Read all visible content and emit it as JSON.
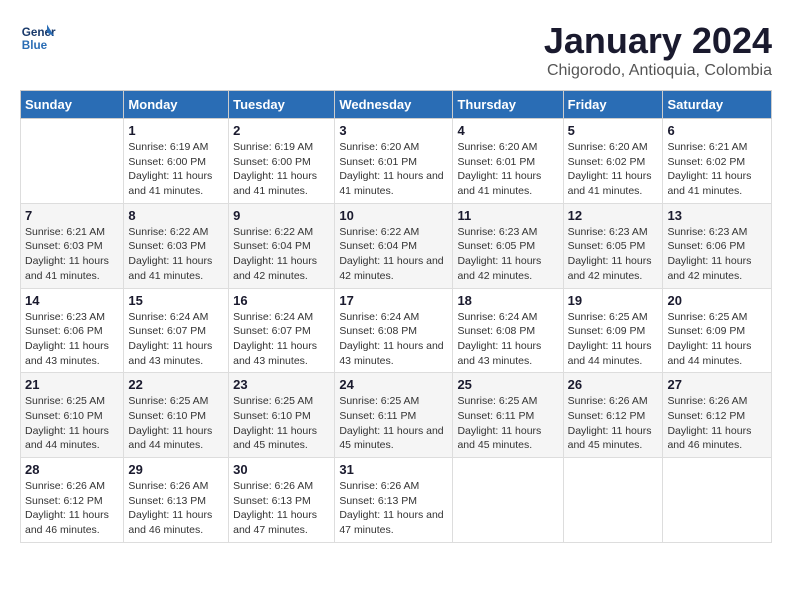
{
  "logo": {
    "line1": "General",
    "line2": "Blue"
  },
  "title": "January 2024",
  "subtitle": "Chigorodo, Antioquia, Colombia",
  "days_of_week": [
    "Sunday",
    "Monday",
    "Tuesday",
    "Wednesday",
    "Thursday",
    "Friday",
    "Saturday"
  ],
  "weeks": [
    [
      {
        "num": "",
        "sunrise": "",
        "sunset": "",
        "daylight": ""
      },
      {
        "num": "1",
        "sunrise": "Sunrise: 6:19 AM",
        "sunset": "Sunset: 6:00 PM",
        "daylight": "Daylight: 11 hours and 41 minutes."
      },
      {
        "num": "2",
        "sunrise": "Sunrise: 6:19 AM",
        "sunset": "Sunset: 6:00 PM",
        "daylight": "Daylight: 11 hours and 41 minutes."
      },
      {
        "num": "3",
        "sunrise": "Sunrise: 6:20 AM",
        "sunset": "Sunset: 6:01 PM",
        "daylight": "Daylight: 11 hours and 41 minutes."
      },
      {
        "num": "4",
        "sunrise": "Sunrise: 6:20 AM",
        "sunset": "Sunset: 6:01 PM",
        "daylight": "Daylight: 11 hours and 41 minutes."
      },
      {
        "num": "5",
        "sunrise": "Sunrise: 6:20 AM",
        "sunset": "Sunset: 6:02 PM",
        "daylight": "Daylight: 11 hours and 41 minutes."
      },
      {
        "num": "6",
        "sunrise": "Sunrise: 6:21 AM",
        "sunset": "Sunset: 6:02 PM",
        "daylight": "Daylight: 11 hours and 41 minutes."
      }
    ],
    [
      {
        "num": "7",
        "sunrise": "Sunrise: 6:21 AM",
        "sunset": "Sunset: 6:03 PM",
        "daylight": "Daylight: 11 hours and 41 minutes."
      },
      {
        "num": "8",
        "sunrise": "Sunrise: 6:22 AM",
        "sunset": "Sunset: 6:03 PM",
        "daylight": "Daylight: 11 hours and 41 minutes."
      },
      {
        "num": "9",
        "sunrise": "Sunrise: 6:22 AM",
        "sunset": "Sunset: 6:04 PM",
        "daylight": "Daylight: 11 hours and 42 minutes."
      },
      {
        "num": "10",
        "sunrise": "Sunrise: 6:22 AM",
        "sunset": "Sunset: 6:04 PM",
        "daylight": "Daylight: 11 hours and 42 minutes."
      },
      {
        "num": "11",
        "sunrise": "Sunrise: 6:23 AM",
        "sunset": "Sunset: 6:05 PM",
        "daylight": "Daylight: 11 hours and 42 minutes."
      },
      {
        "num": "12",
        "sunrise": "Sunrise: 6:23 AM",
        "sunset": "Sunset: 6:05 PM",
        "daylight": "Daylight: 11 hours and 42 minutes."
      },
      {
        "num": "13",
        "sunrise": "Sunrise: 6:23 AM",
        "sunset": "Sunset: 6:06 PM",
        "daylight": "Daylight: 11 hours and 42 minutes."
      }
    ],
    [
      {
        "num": "14",
        "sunrise": "Sunrise: 6:23 AM",
        "sunset": "Sunset: 6:06 PM",
        "daylight": "Daylight: 11 hours and 43 minutes."
      },
      {
        "num": "15",
        "sunrise": "Sunrise: 6:24 AM",
        "sunset": "Sunset: 6:07 PM",
        "daylight": "Daylight: 11 hours and 43 minutes."
      },
      {
        "num": "16",
        "sunrise": "Sunrise: 6:24 AM",
        "sunset": "Sunset: 6:07 PM",
        "daylight": "Daylight: 11 hours and 43 minutes."
      },
      {
        "num": "17",
        "sunrise": "Sunrise: 6:24 AM",
        "sunset": "Sunset: 6:08 PM",
        "daylight": "Daylight: 11 hours and 43 minutes."
      },
      {
        "num": "18",
        "sunrise": "Sunrise: 6:24 AM",
        "sunset": "Sunset: 6:08 PM",
        "daylight": "Daylight: 11 hours and 43 minutes."
      },
      {
        "num": "19",
        "sunrise": "Sunrise: 6:25 AM",
        "sunset": "Sunset: 6:09 PM",
        "daylight": "Daylight: 11 hours and 44 minutes."
      },
      {
        "num": "20",
        "sunrise": "Sunrise: 6:25 AM",
        "sunset": "Sunset: 6:09 PM",
        "daylight": "Daylight: 11 hours and 44 minutes."
      }
    ],
    [
      {
        "num": "21",
        "sunrise": "Sunrise: 6:25 AM",
        "sunset": "Sunset: 6:10 PM",
        "daylight": "Daylight: 11 hours and 44 minutes."
      },
      {
        "num": "22",
        "sunrise": "Sunrise: 6:25 AM",
        "sunset": "Sunset: 6:10 PM",
        "daylight": "Daylight: 11 hours and 44 minutes."
      },
      {
        "num": "23",
        "sunrise": "Sunrise: 6:25 AM",
        "sunset": "Sunset: 6:10 PM",
        "daylight": "Daylight: 11 hours and 45 minutes."
      },
      {
        "num": "24",
        "sunrise": "Sunrise: 6:25 AM",
        "sunset": "Sunset: 6:11 PM",
        "daylight": "Daylight: 11 hours and 45 minutes."
      },
      {
        "num": "25",
        "sunrise": "Sunrise: 6:25 AM",
        "sunset": "Sunset: 6:11 PM",
        "daylight": "Daylight: 11 hours and 45 minutes."
      },
      {
        "num": "26",
        "sunrise": "Sunrise: 6:26 AM",
        "sunset": "Sunset: 6:12 PM",
        "daylight": "Daylight: 11 hours and 45 minutes."
      },
      {
        "num": "27",
        "sunrise": "Sunrise: 6:26 AM",
        "sunset": "Sunset: 6:12 PM",
        "daylight": "Daylight: 11 hours and 46 minutes."
      }
    ],
    [
      {
        "num": "28",
        "sunrise": "Sunrise: 6:26 AM",
        "sunset": "Sunset: 6:12 PM",
        "daylight": "Daylight: 11 hours and 46 minutes."
      },
      {
        "num": "29",
        "sunrise": "Sunrise: 6:26 AM",
        "sunset": "Sunset: 6:13 PM",
        "daylight": "Daylight: 11 hours and 46 minutes."
      },
      {
        "num": "30",
        "sunrise": "Sunrise: 6:26 AM",
        "sunset": "Sunset: 6:13 PM",
        "daylight": "Daylight: 11 hours and 47 minutes."
      },
      {
        "num": "31",
        "sunrise": "Sunrise: 6:26 AM",
        "sunset": "Sunset: 6:13 PM",
        "daylight": "Daylight: 11 hours and 47 minutes."
      },
      {
        "num": "",
        "sunrise": "",
        "sunset": "",
        "daylight": ""
      },
      {
        "num": "",
        "sunrise": "",
        "sunset": "",
        "daylight": ""
      },
      {
        "num": "",
        "sunrise": "",
        "sunset": "",
        "daylight": ""
      }
    ]
  ]
}
